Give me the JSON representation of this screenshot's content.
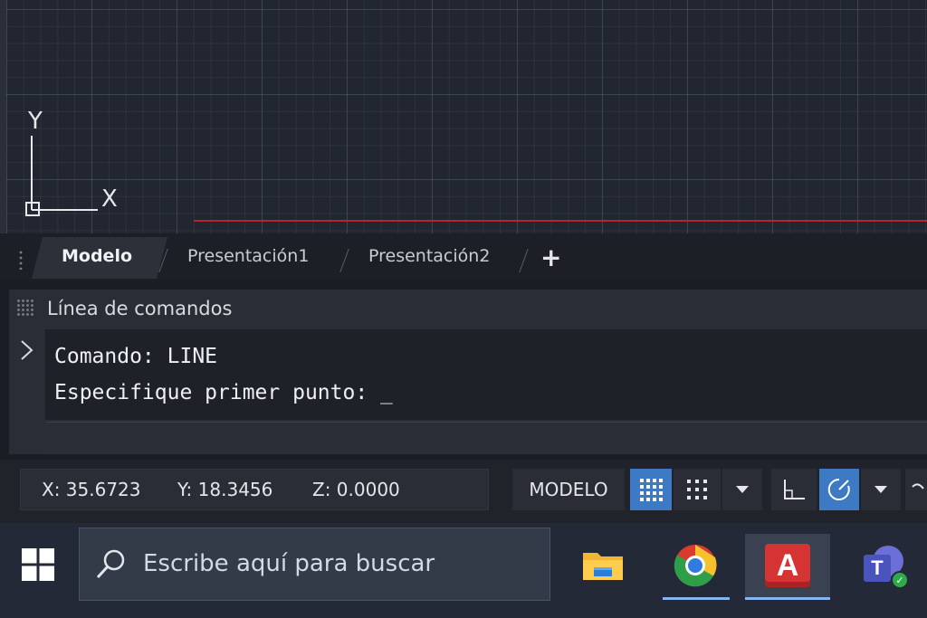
{
  "canvas": {
    "ucs": {
      "y_label": "Y",
      "x_label": "X"
    }
  },
  "layout_tabs": {
    "tabs": [
      {
        "label": "Modelo",
        "active": true
      },
      {
        "label": "Presentación1",
        "active": false
      },
      {
        "label": "Presentación2",
        "active": false
      }
    ],
    "add_label": "+"
  },
  "command_line": {
    "title": "Línea de comandos",
    "history": [
      "Comando: LINE",
      "Especifique primer punto: _"
    ],
    "input_value": ""
  },
  "status_bar": {
    "x": "X: 35.6723",
    "y": "Y: 18.3456",
    "z": "Z: 0.0000",
    "model_label": "MODELO",
    "toggles": [
      {
        "icon": "grid-icon",
        "on": true
      },
      {
        "icon": "snap-icon",
        "on": false
      },
      {
        "icon": "chevron-down-icon",
        "on": false
      },
      {
        "icon": "ortho-icon",
        "on": false
      },
      {
        "icon": "polar-tracking-icon",
        "on": true
      },
      {
        "icon": "chevron-down-icon",
        "on": false
      }
    ]
  },
  "taskbar": {
    "search_placeholder": "Escribe aquí para buscar",
    "apps": [
      {
        "name": "file-explorer",
        "icon": "folder-icon",
        "active": false,
        "running": false
      },
      {
        "name": "chrome",
        "icon": "chrome-icon",
        "active": false,
        "running": true
      },
      {
        "name": "autocad",
        "icon": "autocad-icon",
        "active": true,
        "running": true
      },
      {
        "name": "teams",
        "icon": "teams-icon",
        "active": false,
        "running": false
      }
    ],
    "autocad_letter": "A",
    "teams_letter": "T"
  },
  "colors": {
    "accent_blue": "#3e79c4",
    "red_line": "#b5262b",
    "autocad_red": "#d63333"
  }
}
